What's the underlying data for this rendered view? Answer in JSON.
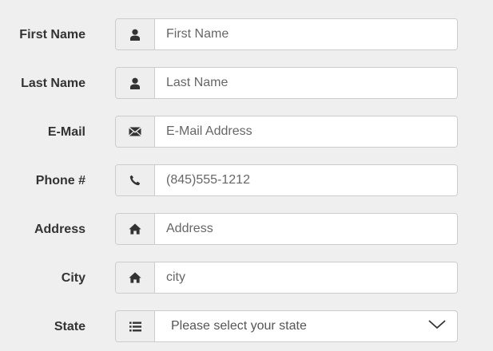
{
  "form": {
    "fields": [
      {
        "label": "First Name",
        "placeholder": "First Name",
        "icon": "user-icon"
      },
      {
        "label": "Last Name",
        "placeholder": "Last Name",
        "icon": "user-icon"
      },
      {
        "label": "E-Mail",
        "placeholder": "E-Mail Address",
        "icon": "envelope-icon"
      },
      {
        "label": "Phone #",
        "placeholder": "(845)555-1212",
        "icon": "phone-icon"
      },
      {
        "label": "Address",
        "placeholder": "Address",
        "icon": "home-icon"
      },
      {
        "label": "City",
        "placeholder": "city",
        "icon": "home-icon"
      }
    ],
    "state": {
      "label": "State",
      "selected": "Please select your state",
      "icon": "list-icon"
    }
  },
  "colors": {
    "background": "#efefef",
    "label": "#333333",
    "addon": "#eeeeee",
    "border": "#cccccc",
    "placeholder": "#666666"
  }
}
